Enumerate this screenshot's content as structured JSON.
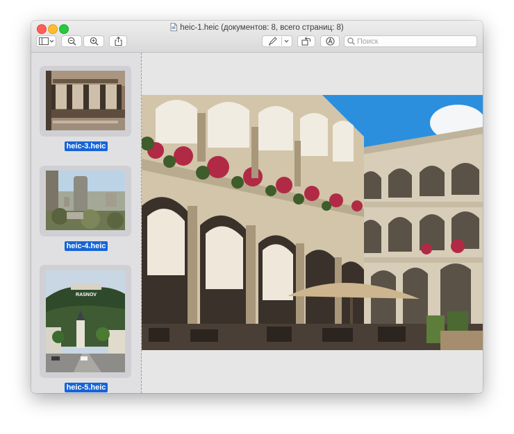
{
  "window": {
    "title": "heic-1.heic (документов: 8, всего страниц: 8)"
  },
  "toolbar": {
    "search_placeholder": "Поиск"
  },
  "sidebar": {
    "items": [
      {
        "label": "heic-3.heic"
      },
      {
        "label": "heic-4.heic"
      },
      {
        "label": "heic-5.heic",
        "image_text": "RASNOV"
      }
    ]
  },
  "icons": {
    "sidebar_toggle": "sidebar-icon",
    "zoom_out": "zoom-out-icon",
    "zoom_in": "zoom-in-icon",
    "share": "share-icon",
    "markup": "pen-icon",
    "rotate": "rotate-icon",
    "annotate": "markup-circle-icon",
    "search": "search-icon"
  },
  "colors": {
    "selection": "#1565d7",
    "close": "#fd5f57",
    "minimize": "#febc2e",
    "maximize": "#28c840"
  }
}
